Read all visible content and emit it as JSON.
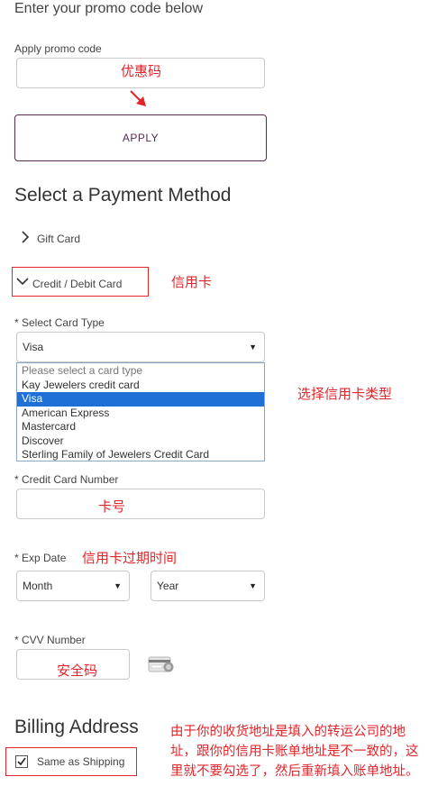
{
  "promo": {
    "intro": "Enter your promo code below",
    "label": "Apply promo code",
    "annotation": "优惠码",
    "apply_label": "APPLY"
  },
  "payment": {
    "title": "Select a Payment Method",
    "gift_card": "Gift Card",
    "credit_card": "Credit / Debit Card",
    "credit_annotation": "信用卡",
    "card_type_label": "* Select Card Type",
    "card_type_value": "Visa",
    "card_type_options": [
      "Please select a card type",
      "Kay Jewelers credit card",
      "Visa",
      "American Express",
      "Mastercard",
      "Discover",
      "Sterling Family of Jewelers Credit Card"
    ],
    "card_type_annotation": "选择信用卡类型",
    "card_number_label": "* Credit Card Number",
    "card_number_annotation": "卡号",
    "exp_label": "* Exp Date",
    "exp_annotation": "信用卡过期时间",
    "month_value": "Month",
    "year_value": "Year",
    "cvv_label": "* CVV Number",
    "cvv_annotation": "安全码"
  },
  "billing": {
    "title": "Billing Address",
    "same_as_shipping": "Same as Shipping",
    "annotation_line1": "由于你的收货地址是填入的转运公司的地",
    "annotation_line2": "址，跟你的信用卡账单地址是不一致的，这",
    "annotation_line3": "里就不要勾选了，然后重新填入账单地址。"
  },
  "icons": [
    "chevron-right-icon",
    "chevron-down-icon",
    "arrow-icon",
    "credit-card-cvv-icon",
    "checkmark-icon"
  ],
  "colors": {
    "accent": "#5a2a4e",
    "annotation": "#e0262b",
    "selection": "#1e70d6"
  }
}
